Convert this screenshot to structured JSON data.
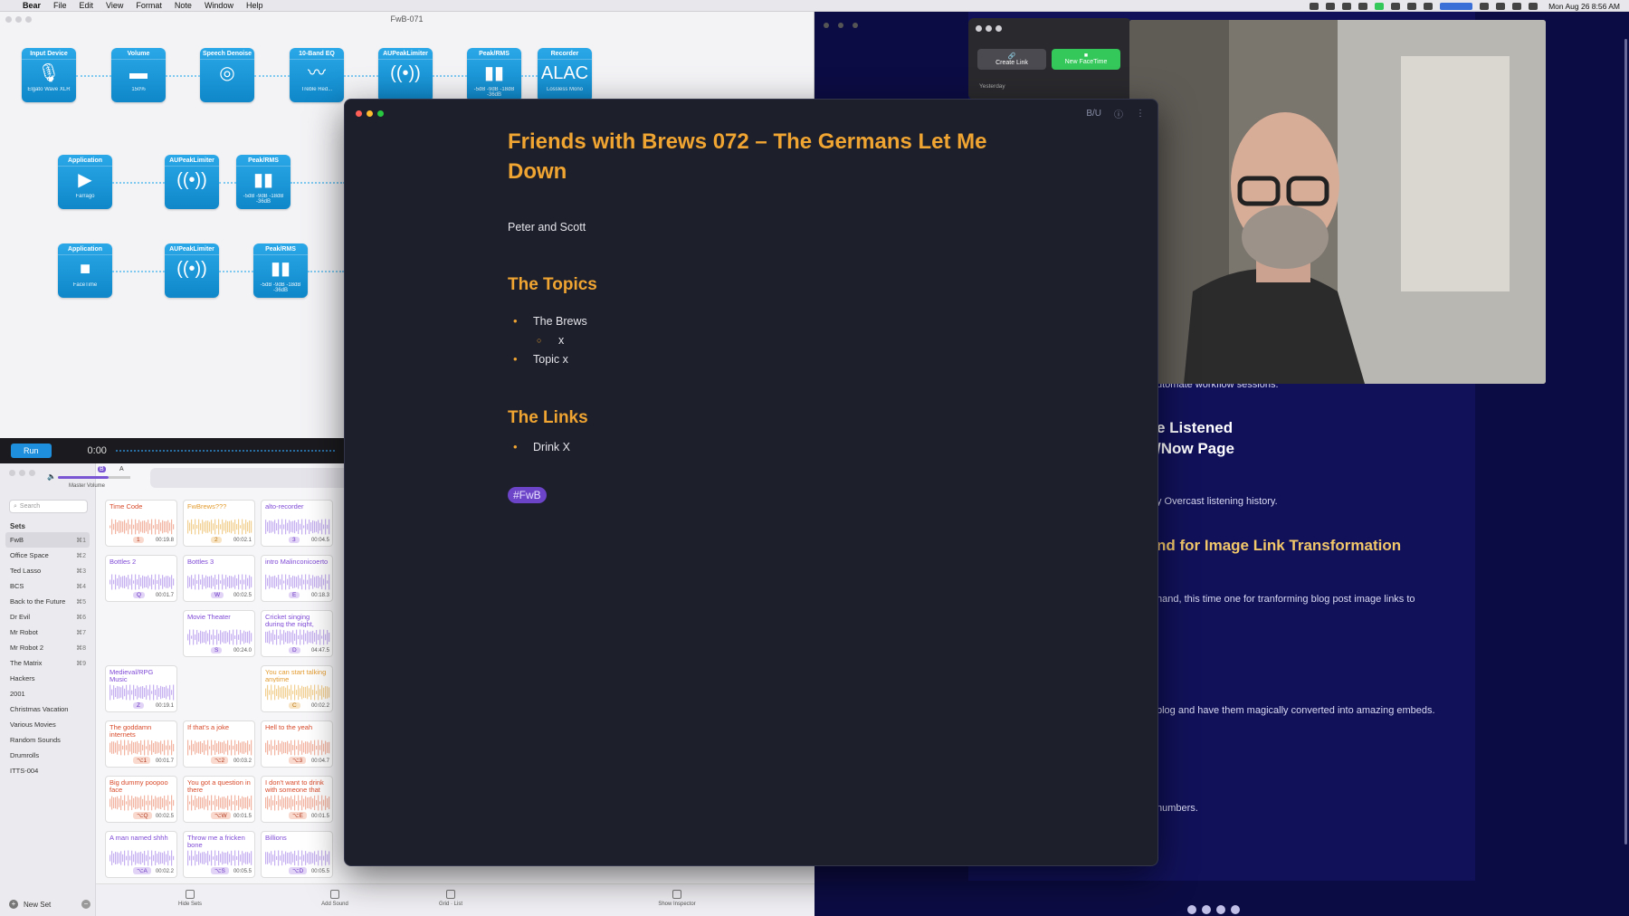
{
  "menubar": {
    "app": "Bear",
    "items": [
      "File",
      "Edit",
      "View",
      "Format",
      "Note",
      "Window",
      "Help"
    ],
    "clock": "Mon Aug 26  8:56 AM"
  },
  "hijack": {
    "title": "FwB-071",
    "nodes": [
      {
        "title": "Input Device",
        "glyph": "🎙",
        "sub": "Elgato Wave XLR"
      },
      {
        "title": "Volume",
        "glyph": "▬",
        "sub": "150%"
      },
      {
        "title": "Speech Denoise",
        "glyph": "◎",
        "sub": ""
      },
      {
        "title": "10-Band EQ",
        "glyph": "〰",
        "sub": "Treble Red..."
      },
      {
        "title": "AUPeakLimiter",
        "glyph": "((•))",
        "sub": ""
      },
      {
        "title": "Peak/RMS",
        "glyph": "▮▮",
        "sub": "-5dB -9dB -18dB -36dB"
      },
      {
        "title": "Recorder",
        "glyph": "ALAC",
        "sub": "Lossless Mono"
      },
      {
        "title": "Application",
        "glyph": "▶",
        "sub": "Farrago"
      },
      {
        "title": "AUPeakLimiter",
        "glyph": "((•))",
        "sub": ""
      },
      {
        "title": "Peak/RMS",
        "glyph": "▮▮",
        "sub": "-5dB -9dB -18dB -36dB"
      },
      {
        "title": "Application",
        "glyph": "■",
        "sub": "FaceTime"
      },
      {
        "title": "AUPeakLimiter",
        "glyph": "((•))",
        "sub": ""
      },
      {
        "title": "Peak/RMS",
        "glyph": "▮▮",
        "sub": "-5dB -9dB -18dB -36dB"
      }
    ],
    "run_label": "Run",
    "time": "0:00"
  },
  "farrago": {
    "master_volume": "Master Volume",
    "search_placeholder": "Search",
    "sets_heading": "Sets",
    "sets": [
      {
        "name": "FwB",
        "key": "⌘1"
      },
      {
        "name": "Office Space",
        "key": "⌘2"
      },
      {
        "name": "Ted Lasso",
        "key": "⌘3"
      },
      {
        "name": "BCS",
        "key": "⌘4"
      },
      {
        "name": "Back to the Future",
        "key": "⌘5"
      },
      {
        "name": "Dr Evil",
        "key": "⌘6"
      },
      {
        "name": "Mr Robot",
        "key": "⌘7"
      },
      {
        "name": "Mr Robot 2",
        "key": "⌘8"
      },
      {
        "name": "The Matrix",
        "key": "⌘9"
      },
      {
        "name": "Hackers",
        "key": ""
      },
      {
        "name": "2001",
        "key": ""
      },
      {
        "name": "Christmas Vacation",
        "key": ""
      },
      {
        "name": "Various Movies",
        "key": ""
      },
      {
        "name": "Random Sounds",
        "key": ""
      },
      {
        "name": "Drumrolls",
        "key": ""
      },
      {
        "name": "ITTS-004",
        "key": ""
      }
    ],
    "new_set": "New Set",
    "tiles": [
      {
        "title": "Time Code",
        "key": "1",
        "dur": "00:19.8",
        "color": "red"
      },
      {
        "title": "FwBrews???",
        "key": "2",
        "dur": "00:02.1",
        "color": "orange"
      },
      {
        "title": "alto-recorder",
        "key": "3",
        "dur": "00:04.5",
        "color": "purple"
      },
      {
        "title": "Bottles 2",
        "key": "Q",
        "dur": "00:01.7",
        "color": "purple"
      },
      {
        "title": "Bottles 3",
        "key": "W",
        "dur": "00:02.5",
        "color": "purple"
      },
      {
        "title": "intro Malinconicoerto",
        "key": "E",
        "dur": "00:18.3",
        "color": "purple"
      },
      {
        "title": "Movie Theater",
        "key": "S",
        "dur": "00:24.0",
        "color": "purple"
      },
      {
        "title": "Cricket singing during the night, close recording",
        "key": "D",
        "dur": "04:47.5",
        "color": "purple"
      },
      {
        "title": "Medieval/RPG Music",
        "key": "Z",
        "dur": "00:19.1",
        "color": "purple"
      },
      {
        "title": "You can start talking anytime",
        "key": "C",
        "dur": "00:02.2",
        "color": "orange"
      },
      {
        "title": "The goddamn internets",
        "key": "⌥1",
        "dur": "00:01.7",
        "color": "red"
      },
      {
        "title": "If that's a joke",
        "key": "⌥2",
        "dur": "00:03.2",
        "color": "red"
      },
      {
        "title": "Hell to the yeah",
        "key": "⌥3",
        "dur": "00:04.7",
        "color": "red"
      },
      {
        "title": "Big dummy poopoo face",
        "key": "⌥Q",
        "dur": "00:02.5",
        "color": "red"
      },
      {
        "title": "You got a question in there",
        "key": "⌥W",
        "dur": "00:01.5",
        "color": "red"
      },
      {
        "title": "I don't want to drink with someone that selfish",
        "key": "⌥E",
        "dur": "00:01.5",
        "color": "red"
      },
      {
        "title": "A man named shhh",
        "key": "⌥A",
        "dur": "00:02.2",
        "color": "purple"
      },
      {
        "title": "Throw me a fricken bone",
        "key": "⌥S",
        "dur": "00:05.5",
        "color": "purple"
      },
      {
        "title": "Billions",
        "key": "⌥D",
        "dur": "00:05.5",
        "color": "purple"
      }
    ],
    "bottom": {
      "hide_sets": "Hide Sets",
      "add_sound": "Add Sound",
      "grid_list": "Grid · List",
      "show_inspector": "Show Inspector"
    }
  },
  "facetime": {
    "create_link": "Create Link",
    "new_facetime": "New FaceTime",
    "yesterday": "Yesterday"
  },
  "browser": {
    "fragments": [
      "utomate workflow sessions.",
      "e Listened",
      "/Now Page",
      "y Overcast listening history.",
      "nd for Image Link Transformation",
      "nand, this time one for tranforming blog post image links to",
      "blog and have them magically converted into amazing embeds.",
      "numbers."
    ]
  },
  "bear": {
    "title": "Friends with Brews 072 – The Germans Let Me Down",
    "byline": "Peter and Scott",
    "topics_heading": "The Topics",
    "topics": [
      "The Brews",
      "x",
      "Topic x"
    ],
    "links_heading": "The Links",
    "links": [
      "Drink X"
    ],
    "tag": "#FwB",
    "toolbar_biu": "B/U"
  }
}
